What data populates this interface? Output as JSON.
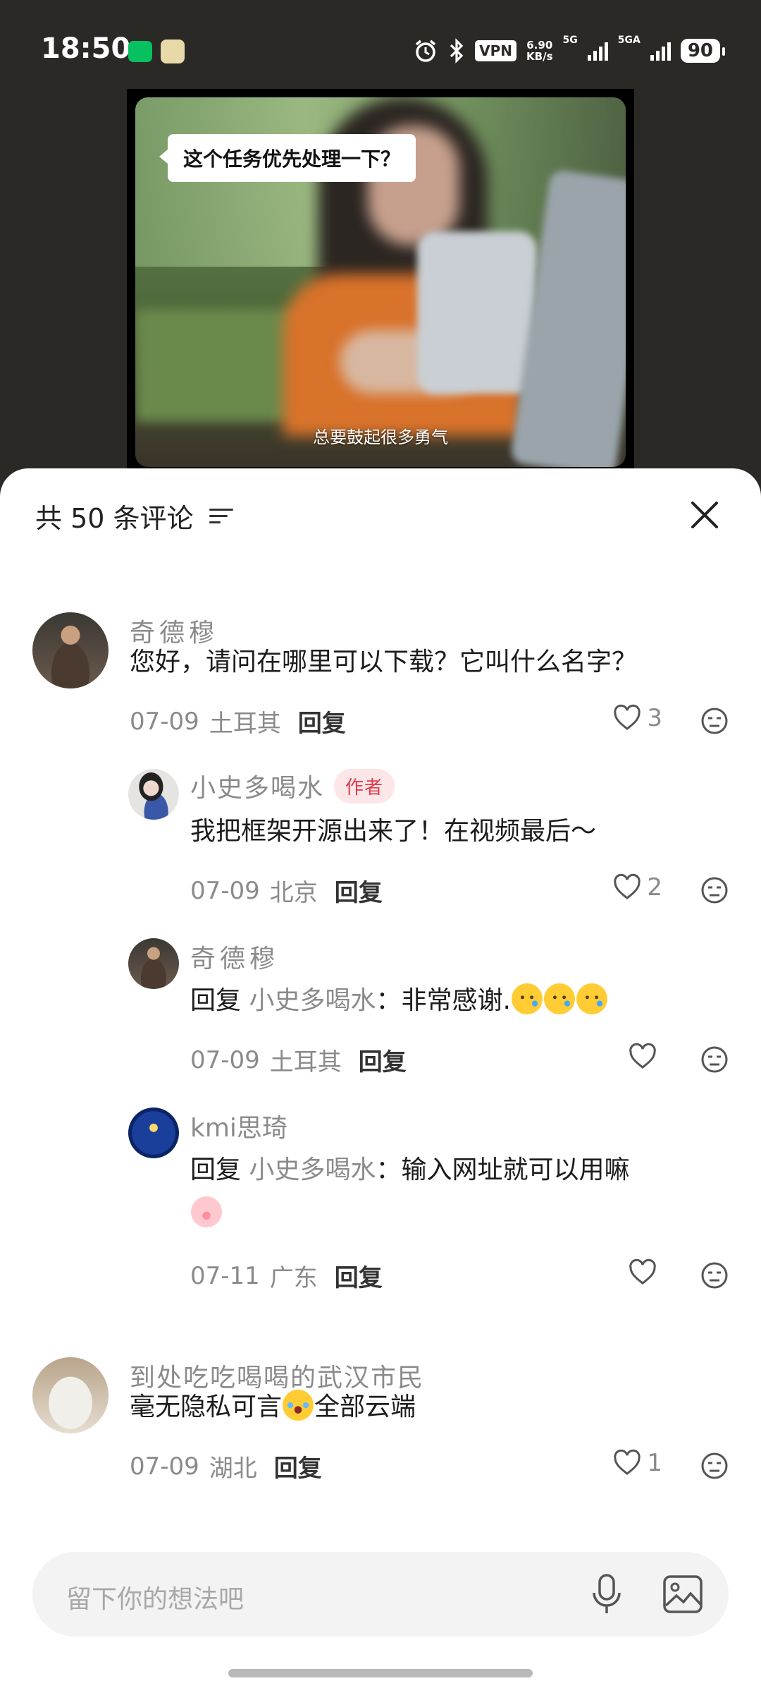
{
  "status_bar": {
    "time": "18:50",
    "vpn": "VPN",
    "net_speed_value": "6.90",
    "net_speed_unit": "KB/s",
    "sim1_label": "5G",
    "sim2_label": "5GA",
    "battery": "90"
  },
  "video": {
    "bubble_text": "这个任务优先处理一下？",
    "subtitle": "总要鼓起很多勇气"
  },
  "sheet": {
    "title": "共 50 条评论"
  },
  "comments": [
    {
      "name": "奇德穆",
      "text": "您好，请问在哪里可以下载？它叫什么名字？",
      "date": "07-09",
      "location": "土耳其",
      "reply_label": "回复",
      "likes": "3"
    },
    {
      "name": "小史多喝水",
      "author_tag": "作者",
      "text": "我把框架开源出来了！在视频最后～",
      "date": "07-09",
      "location": "北京",
      "reply_label": "回复",
      "likes": "2"
    },
    {
      "name": "奇德穆",
      "reply_prefix": "回复",
      "mention": "小史多喝水",
      "text": "：非常感谢.",
      "date": "07-09",
      "location": "土耳其",
      "reply_label": "回复",
      "likes": ""
    },
    {
      "name": "kmi思琦",
      "reply_prefix": "回复",
      "mention": "小史多喝水",
      "text": "：输入网址就可以用嘛",
      "date": "07-11",
      "location": "广东",
      "reply_label": "回复",
      "likes": ""
    },
    {
      "name": "到处吃吃喝喝的武汉市民",
      "text_before": "毫无隐私可言",
      "text_after": "全部云端",
      "date": "07-09",
      "location": "湖北",
      "reply_label": "回复",
      "likes": "1"
    }
  ],
  "input": {
    "placeholder": "留下你的想法吧"
  },
  "icons": {
    "filter": "filter-icon",
    "close": "close-icon",
    "like": "heart-icon",
    "dislike": "dislike-face-icon",
    "mic": "microphone-icon",
    "image": "image-icon"
  },
  "colors": {
    "author_tag": "#e03c4a",
    "author_tag_bg": "#fde6e8",
    "secondary_text": "#8a8a8a"
  }
}
